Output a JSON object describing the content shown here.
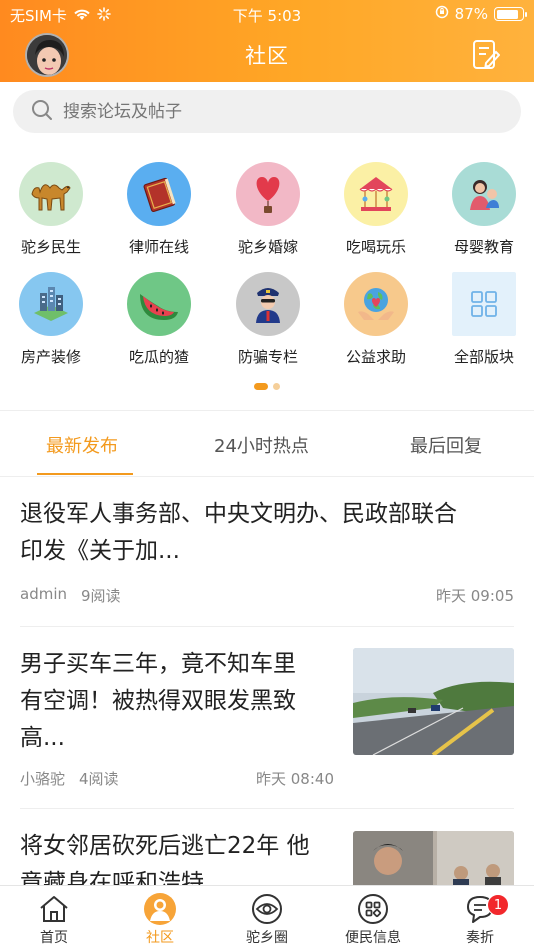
{
  "status_bar": {
    "carrier": "无SIM卡",
    "time": "下午 5:03",
    "battery": "87%"
  },
  "header": {
    "title": "社区"
  },
  "search": {
    "placeholder": "搜索论坛及帖子"
  },
  "categories": [
    {
      "label": "驼乡民生",
      "icon": "camel-icon",
      "bg": "#cfe9cf"
    },
    {
      "label": "律师在线",
      "icon": "law-book-icon",
      "bg": "#5aaef0"
    },
    {
      "label": "驼乡婚嫁",
      "icon": "heart-balloon-icon",
      "bg": "#f2b8c6"
    },
    {
      "label": "吃喝玩乐",
      "icon": "carousel-icon",
      "bg": "#fbf0a5"
    },
    {
      "label": "母婴教育",
      "icon": "mother-baby-icon",
      "bg": "#a9dcd6"
    },
    {
      "label": "房产装修",
      "icon": "buildings-icon",
      "bg": "#86c7f0"
    },
    {
      "label": "吃瓜的猹",
      "icon": "watermelon-icon",
      "bg": "#6fc786"
    },
    {
      "label": "防骗专栏",
      "icon": "police-icon",
      "bg": "#c8c8c8"
    },
    {
      "label": "公益求助",
      "icon": "earth-hands-icon",
      "bg": "#f7c98c"
    },
    {
      "label": "全部版块",
      "icon": "grid-icon",
      "bg": "#e3f1fb"
    }
  ],
  "carousel": {
    "pages": 2,
    "active": 0
  },
  "tabs": [
    {
      "label": "最新发布",
      "active": true
    },
    {
      "label": "24小时热点",
      "active": false
    },
    {
      "label": "最后回复",
      "active": false
    }
  ],
  "posts": [
    {
      "title_line1": "退役军人事务部、中央文明办、民政部联合",
      "title_line2": "印发《关于加...",
      "author": "admin",
      "reads": "9阅读",
      "time": "昨天 09:05"
    },
    {
      "title_line1": "男子买车三年，竟不知车里",
      "title_line2": "有空调！被热得双眼发黑致",
      "title_line3": "高...",
      "author": "小骆驼",
      "reads": "4阅读",
      "time": "昨天 08:40"
    },
    {
      "title_line1": "将女邻居砍死后逃亡22年 他",
      "title_line2": "竟藏身在呼和浩特......"
    }
  ],
  "bottom_nav": [
    {
      "label": "首页",
      "icon": "home-icon"
    },
    {
      "label": "社区",
      "icon": "community-icon",
      "active": true
    },
    {
      "label": "驼乡圈",
      "icon": "circle-eye-icon"
    },
    {
      "label": "便民信息",
      "icon": "apps-icon"
    },
    {
      "label": "奏折",
      "icon": "message-icon",
      "badge": "1"
    }
  ],
  "colors": {
    "accent": "#f39a1e",
    "header_start": "#ff8a1f",
    "header_end": "#ffb23d"
  }
}
